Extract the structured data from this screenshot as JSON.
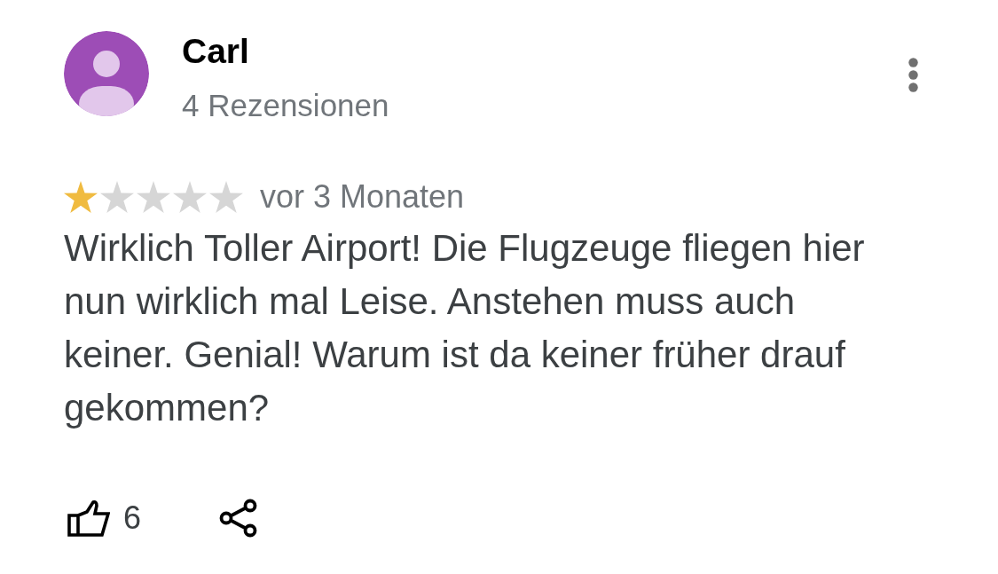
{
  "reviewer": {
    "name": "Carl",
    "review_count": "4 Rezensionen"
  },
  "review": {
    "stars": 1,
    "time": "vor 3 Monaten",
    "text": "Wirklich Toller Airport! Die Flugzeuge fliegen hier nun wirklich mal Leise. Anstehen muss auch keiner. Genial! Warum ist da keiner früher drauf gekommen?"
  },
  "actions": {
    "likes": "6"
  }
}
